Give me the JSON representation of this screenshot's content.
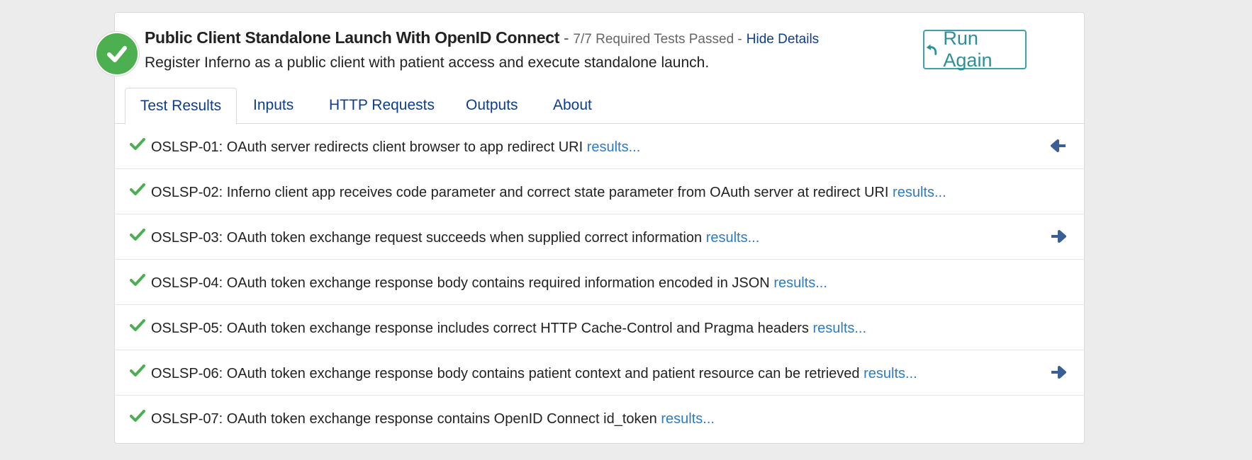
{
  "header": {
    "title": "Public Client Standalone Launch With OpenID Connect",
    "separator": "-",
    "passed": "7/7 Required Tests Passed -",
    "hide_details": "Hide Details",
    "description": "Register Inferno as a public client with patient access and execute standalone launch.",
    "status_icon": "check-circle-icon",
    "status_color": "#4caf50"
  },
  "run_again": {
    "label": "Run Again",
    "icon": "undo-icon",
    "color": "#3fa0a8"
  },
  "tabs": [
    {
      "label": "Test Results",
      "active": true
    },
    {
      "label": "Inputs"
    },
    {
      "label": "HTTP Requests"
    },
    {
      "label": "Outputs"
    },
    {
      "label": "About"
    }
  ],
  "tests": [
    {
      "id": "OSLSP-01:",
      "text": " OAuth server redirects client browser to app redirect URI ",
      "link": "results...",
      "arrow": "arrow-left-icon"
    },
    {
      "id": "OSLSP-02:",
      "text": " Inferno client app receives code parameter and correct state parameter from OAuth server at redirect URI ",
      "link": "results..."
    },
    {
      "id": "OSLSP-03:",
      "text": " OAuth token exchange request succeeds when supplied correct information ",
      "link": "results...",
      "arrow": "arrow-right-icon"
    },
    {
      "id": "OSLSP-04:",
      "text": " OAuth token exchange response body contains required information encoded in JSON ",
      "link": "results..."
    },
    {
      "id": "OSLSP-05:",
      "text": " OAuth token exchange response includes correct HTTP Cache-Control and Pragma headers ",
      "link": "results..."
    },
    {
      "id": "OSLSP-06:",
      "text": " OAuth token exchange response body contains patient context and patient resource can be retrieved ",
      "link": "results...",
      "arrow": "arrow-right-icon"
    },
    {
      "id": "OSLSP-07:",
      "text": " OAuth token exchange response contains OpenID Connect id_token ",
      "link": "results..."
    }
  ],
  "colors": {
    "pass_check": "#4caf50",
    "link": "#2c7bc4",
    "tab_text": "#0d3d8c",
    "arrow": "#3a5f96"
  }
}
